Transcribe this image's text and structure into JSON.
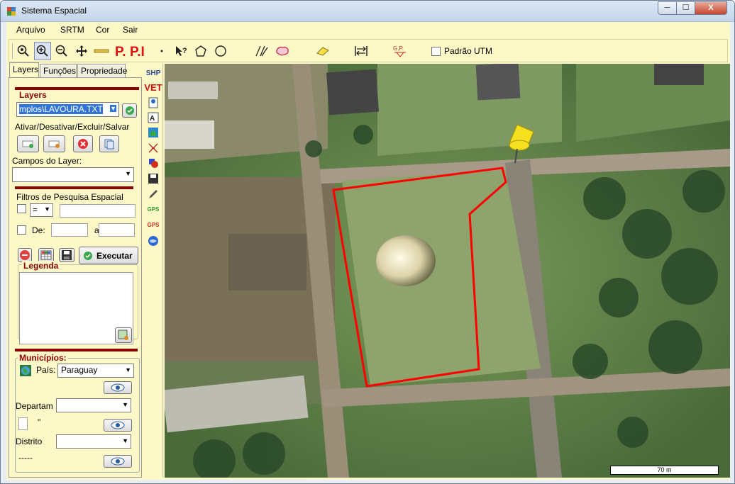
{
  "window": {
    "title": "Sistema Espacial",
    "min": "─",
    "max": "☐",
    "close": "X"
  },
  "menu": [
    "Arquivo",
    "SRTM",
    "Cor",
    "Sair"
  ],
  "toolbar": {
    "utm_label": "Padrão UTM"
  },
  "tabs": [
    "Layers",
    "Funções",
    "Propriedade"
  ],
  "layers": {
    "title": "Layers",
    "current": "mplos\\LAVOURA.TXT",
    "actions_label": "Ativar/Desativar/Excluir/Salvar",
    "fields_label": "Campos do Layer:",
    "filter_title": "Filtros de Pesquisa Espacial",
    "operator": "=",
    "de_label": "De:",
    "a_label": "a",
    "execute_label": "Executar",
    "legend_title": "Legenda"
  },
  "municipios": {
    "title": "Municípios:",
    "pais_label": "País:",
    "pais_value": "Paraguay",
    "departam_label": "Departam",
    "quote": "\"",
    "distrito_label": "Distrito",
    "dashes": "-----"
  },
  "vstrip": [
    "SHP",
    "VET",
    "GPS",
    "GPS"
  ],
  "map": {
    "scale_label": "70 m"
  },
  "colors": {
    "panel": "#fdf8c8",
    "accent": "#8b0000",
    "polygon": "#ff0000"
  }
}
